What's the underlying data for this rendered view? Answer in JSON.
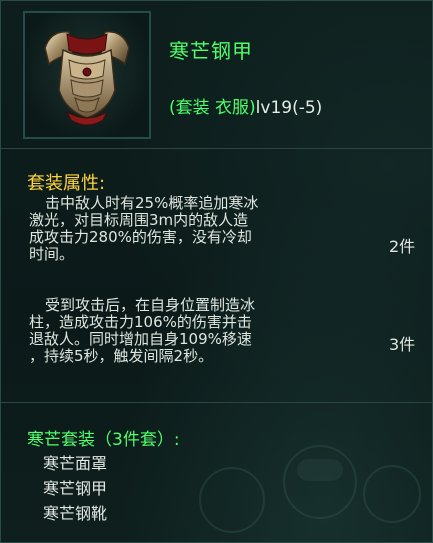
{
  "item": {
    "name": "寒芒钢甲",
    "type": "(套装 衣服)",
    "level": "lv19(-5)",
    "icon": "chest-armor-icon"
  },
  "set_attributes": {
    "title": "套装属性:",
    "effects": [
      {
        "lines": [
          "击中敌人时有25%概率追加寒冰",
          "激光，对目标周围3m内的敌人造",
          "成攻击力280%的伤害，没有冷却",
          "时间。"
        ],
        "pieces": "2件"
      },
      {
        "lines": [
          "受到攻击后，在自身位置制造冰",
          "柱，造成攻击力106%的伤害并击",
          "退敌人。同时增加自身109%移速",
          "，持续5秒，触发间隔2秒。"
        ],
        "pieces": "3件"
      }
    ]
  },
  "set": {
    "title": "寒芒套装（3件套）:",
    "items": [
      "寒芒面罩",
      "寒芒钢甲",
      "寒芒钢靴"
    ]
  },
  "colors": {
    "item_name": "#4dff6a",
    "section_title": "#ffd33a",
    "body_text": "#dfe6df",
    "background": "#0c1a19"
  }
}
